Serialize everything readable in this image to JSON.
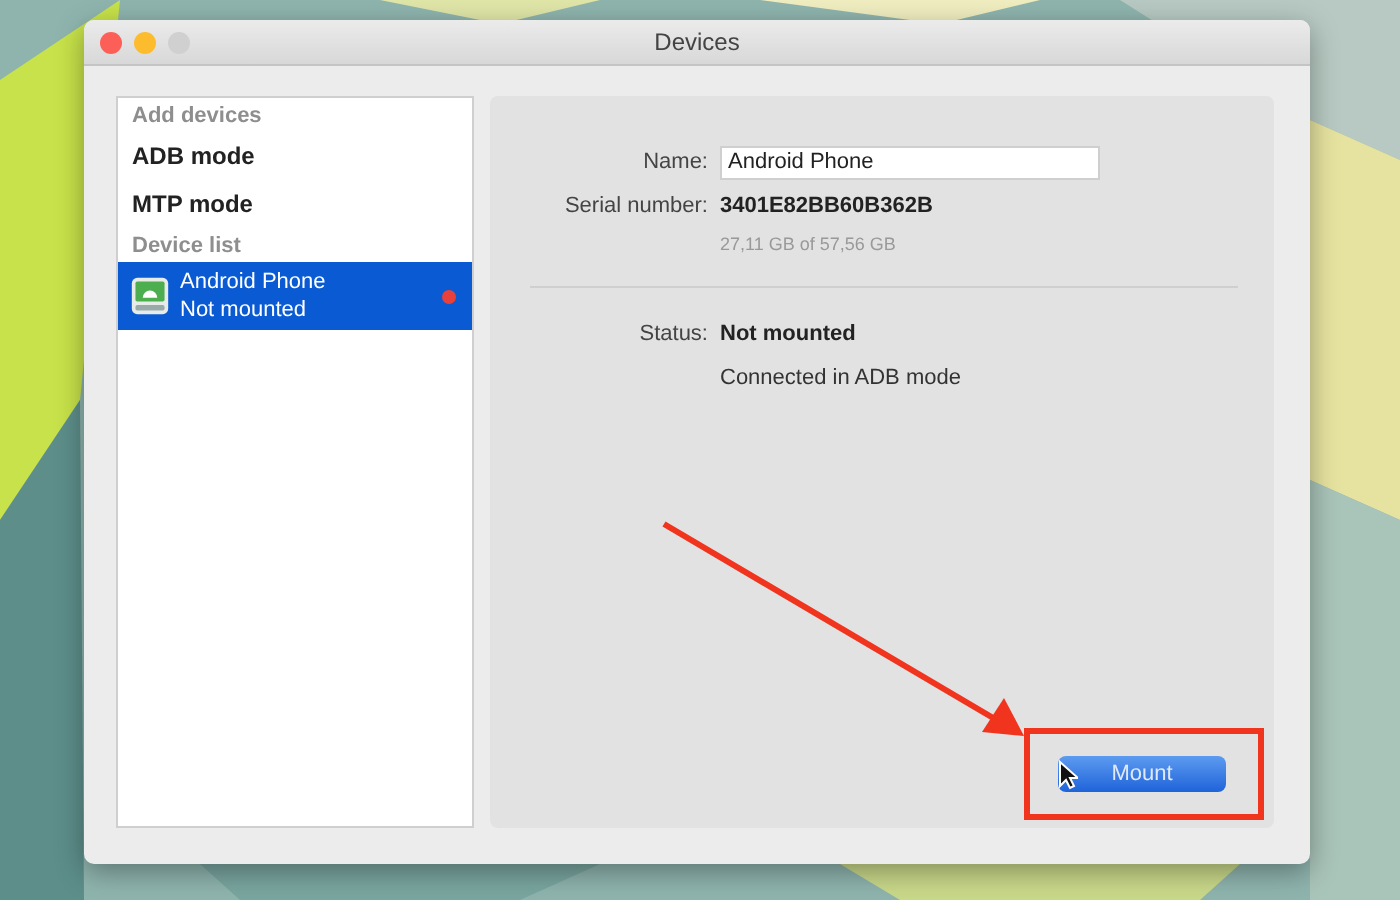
{
  "window": {
    "title": "Devices"
  },
  "sidebar": {
    "items": [
      {
        "kind": "header",
        "label": "Add devices"
      },
      {
        "kind": "action",
        "label": "ADB mode"
      },
      {
        "kind": "action",
        "label": "MTP mode"
      },
      {
        "kind": "header",
        "label": "Device list"
      },
      {
        "kind": "device",
        "label": "Android Phone",
        "sublabel": "Not mounted",
        "selected": true,
        "color": "#e8403a"
      }
    ]
  },
  "details": {
    "name_label": "Name:",
    "name_value": "Android Phone",
    "serial_label": "Serial number:",
    "serial_value": "3401E82BB60B362B",
    "capacity": "27,11 GB of 57,56 GB",
    "status_label": "Status:",
    "status_value": "Not mounted",
    "status_detail": "Connected in ADB mode"
  },
  "mount_button": "Mount"
}
